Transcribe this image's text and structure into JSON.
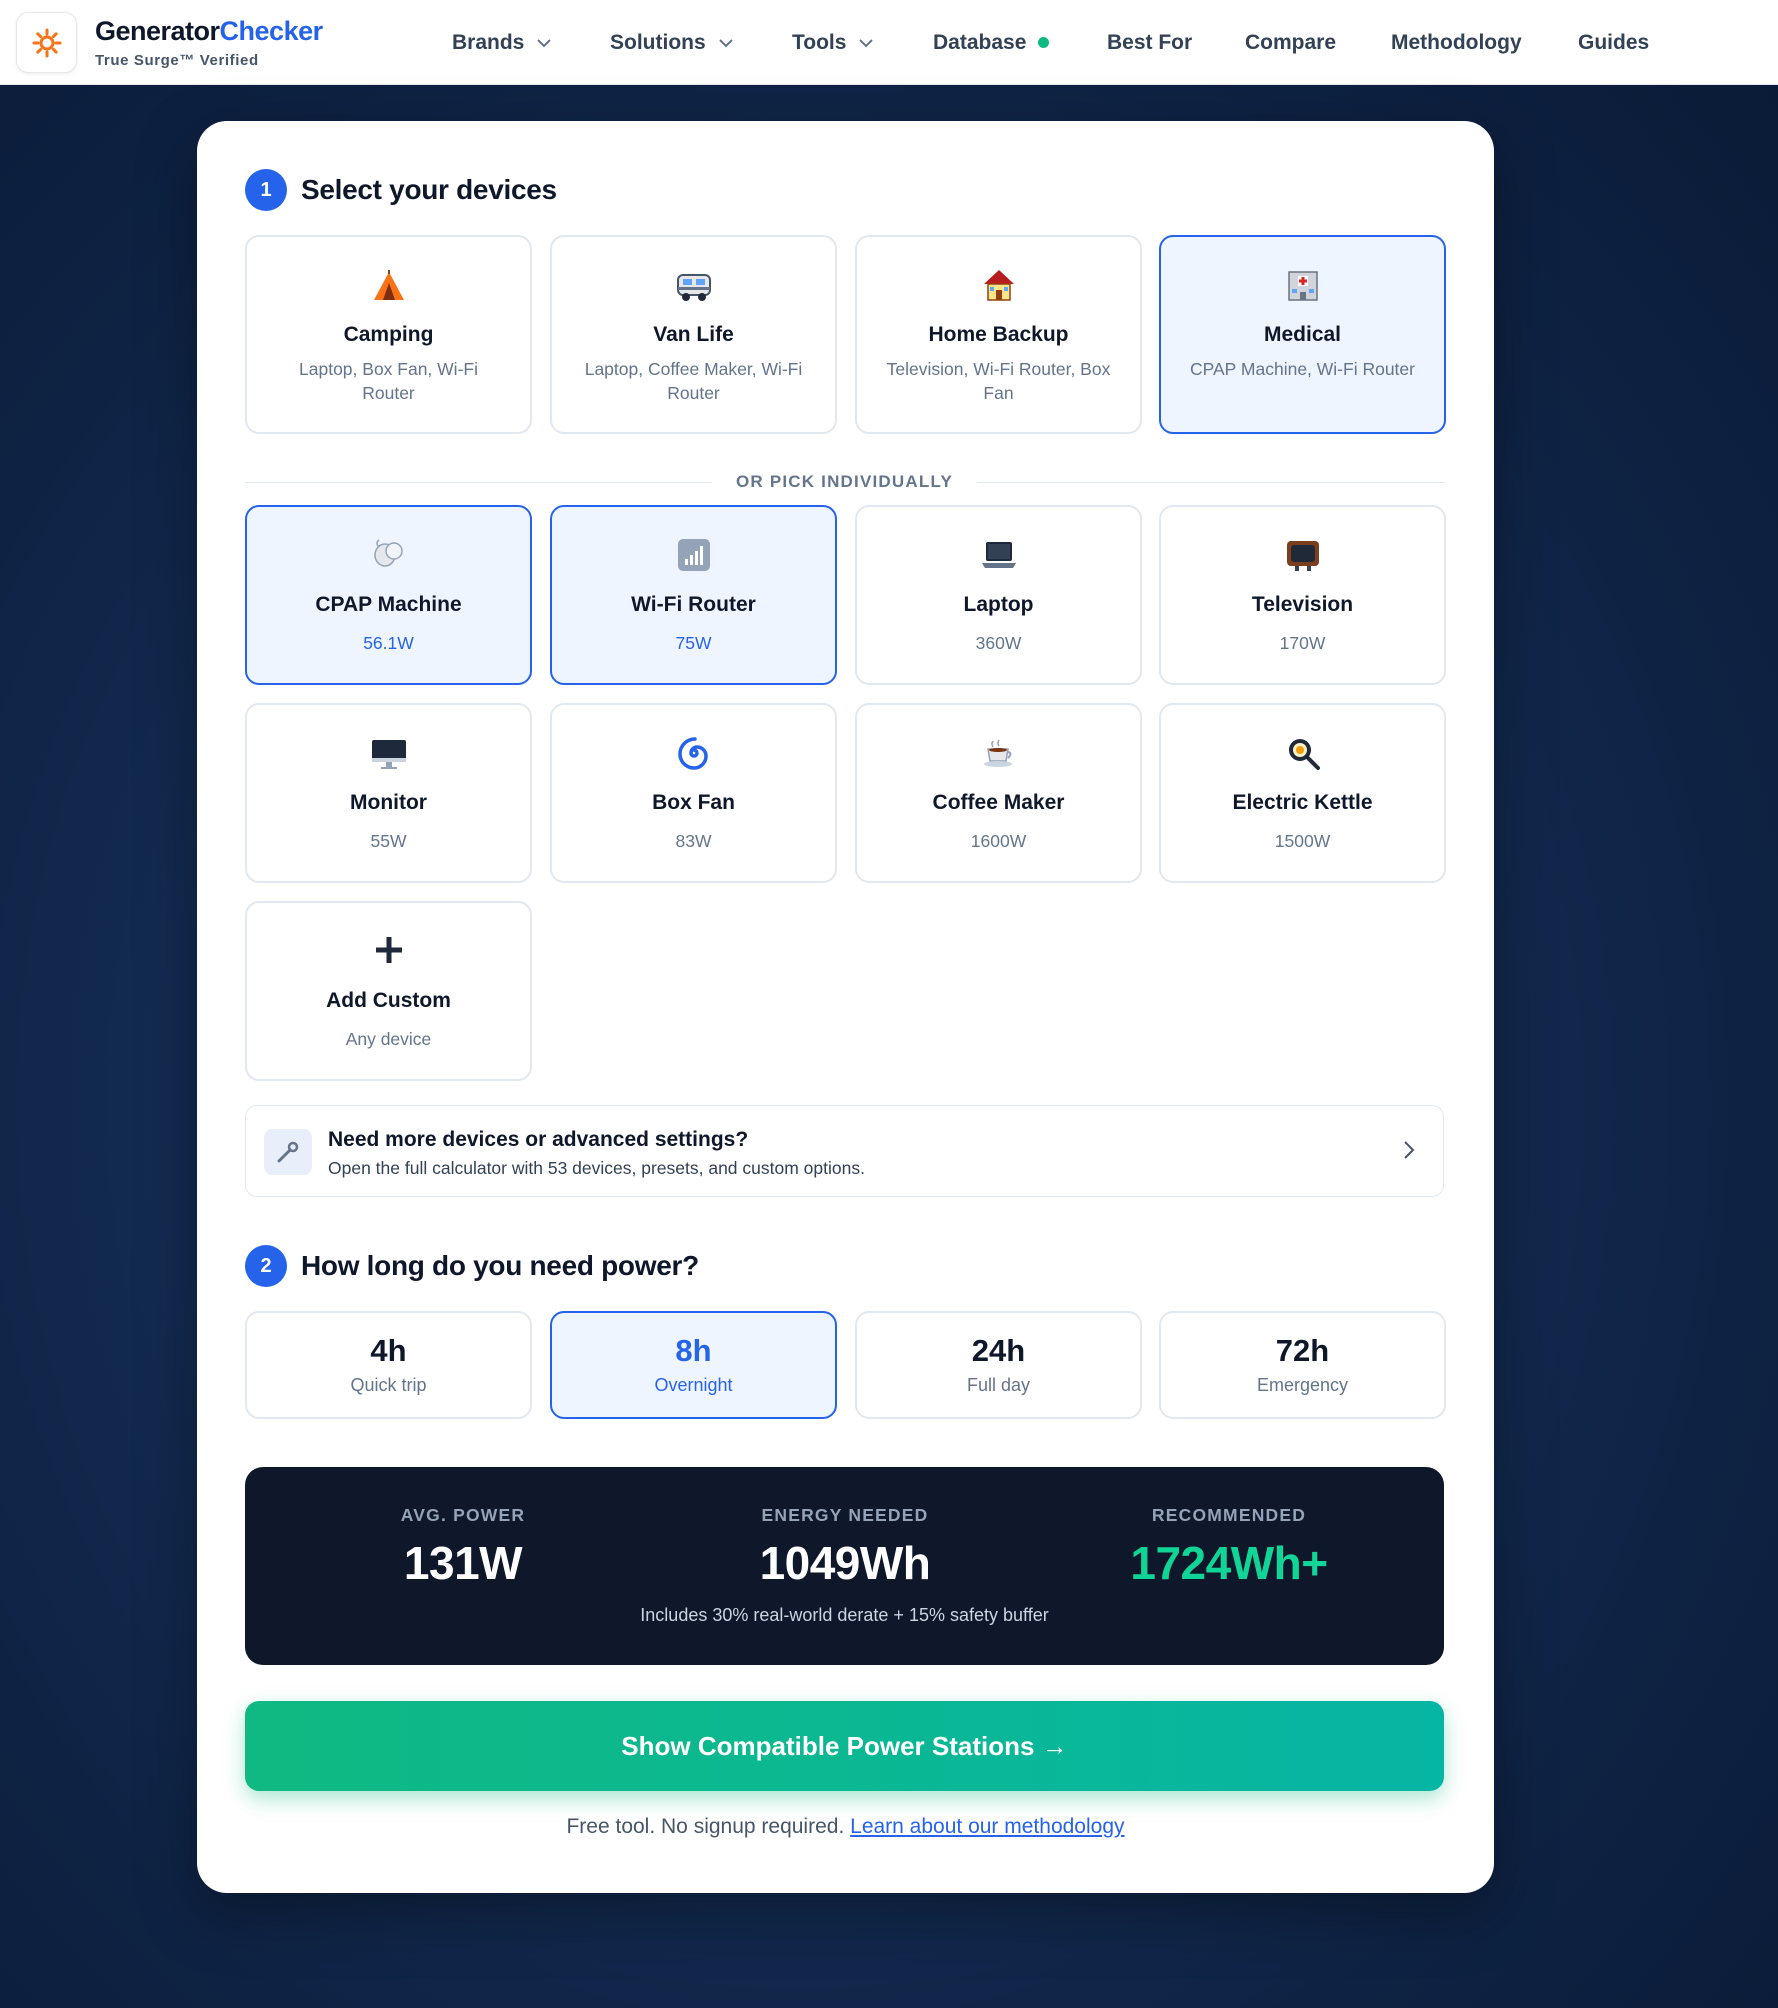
{
  "header": {
    "brand_part1": "Generator",
    "brand_part2": "Checker",
    "tagline": "True Surge™ Verified",
    "nav": [
      {
        "label": "Brands",
        "has_dropdown": true
      },
      {
        "label": "Solutions",
        "has_dropdown": true
      },
      {
        "label": "Tools",
        "has_dropdown": true
      },
      {
        "label": "Database",
        "status_dot": "#10b981"
      },
      {
        "label": "Best For"
      },
      {
        "label": "Compare"
      },
      {
        "label": "Methodology"
      },
      {
        "label": "Guides"
      }
    ]
  },
  "step1": {
    "number": "1",
    "title": "Select your devices",
    "presets": [
      {
        "icon": "tent-icon",
        "name": "Camping",
        "devices": "Laptop, Box Fan, Wi-Fi Router",
        "selected": false
      },
      {
        "icon": "van-icon",
        "name": "Van Life",
        "devices": "Laptop, Coffee Maker, Wi-Fi Router",
        "selected": false
      },
      {
        "icon": "house-icon",
        "name": "Home Backup",
        "devices": "Television, Wi-Fi Router, Box Fan",
        "selected": false
      },
      {
        "icon": "hospital-icon",
        "name": "Medical",
        "devices": "CPAP Machine, Wi-Fi Router",
        "selected": true
      }
    ],
    "divider_text": "OR PICK INDIVIDUALLY",
    "devices": [
      {
        "icon": "cpap-icon",
        "name": "CPAP Machine",
        "watts": "56.1W",
        "selected": true
      },
      {
        "icon": "router-icon",
        "name": "Wi-Fi Router",
        "watts": "75W",
        "selected": true
      },
      {
        "icon": "laptop-icon",
        "name": "Laptop",
        "watts": "360W",
        "selected": false
      },
      {
        "icon": "television-icon",
        "name": "Television",
        "watts": "170W",
        "selected": false
      },
      {
        "icon": "monitor-icon",
        "name": "Monitor",
        "watts": "55W",
        "selected": false
      },
      {
        "icon": "fan-icon",
        "name": "Box Fan",
        "watts": "83W",
        "selected": false
      },
      {
        "icon": "coffee-icon",
        "name": "Coffee Maker",
        "watts": "1600W",
        "selected": false
      },
      {
        "icon": "kettle-icon",
        "name": "Electric Kettle",
        "watts": "1500W",
        "selected": false
      },
      {
        "icon": "plus-icon",
        "name": "Add Custom",
        "watts": "Any device",
        "selected": false
      }
    ],
    "more": {
      "title": "Need more devices or advanced settings?",
      "subtitle": "Open the full calculator with 53 devices, presets, and custom options."
    }
  },
  "step2": {
    "number": "2",
    "title": "How long do you need power?",
    "durations": [
      {
        "value": "4h",
        "label": "Quick trip",
        "selected": false
      },
      {
        "value": "8h",
        "label": "Overnight",
        "selected": true
      },
      {
        "value": "24h",
        "label": "Full day",
        "selected": false
      },
      {
        "value": "72h",
        "label": "Emergency",
        "selected": false
      }
    ]
  },
  "results": {
    "avg_label": "AVG. POWER",
    "avg_value": "131W",
    "energy_label": "ENERGY NEEDED",
    "energy_value": "1049Wh",
    "rec_label": "RECOMMENDED",
    "rec_value": "1724Wh+",
    "note": "Includes 30% real-world derate + 15% safety buffer"
  },
  "cta": {
    "label": "Show Compatible Power Stations →"
  },
  "footer": {
    "text": "Free tool. No signup required.",
    "link": "Learn about our methodology"
  },
  "colors": {
    "accent": "#2563eb",
    "success": "#10b981",
    "dark_panel": "#0f172a"
  }
}
